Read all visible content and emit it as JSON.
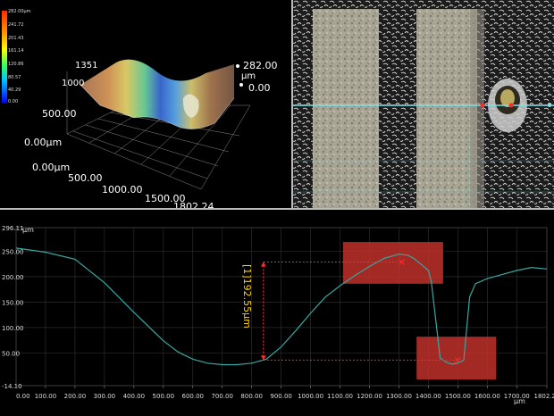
{
  "view3d": {
    "colorbar_labels": [
      "282.00µm",
      "241.72",
      "201.43",
      "161.14",
      "120.86",
      "80.57",
      "40.29",
      "0.00"
    ],
    "z_max": "282.00",
    "z_unit": "µm",
    "z_min": "0.00",
    "y_ticks": [
      "1351",
      "1000",
      "500.00",
      "0.00µm"
    ],
    "x_ticks": [
      "0.00µm",
      "500.00",
      "1000.00",
      "1500.00",
      "1802.24"
    ],
    "colors": {
      "colorbar_top": "#ff3b00",
      "colorbar_mid": "#ffff00",
      "colorbar_low": "#00c0ff",
      "colorbar_bottom": "#0000ff"
    }
  },
  "profile": {
    "y_unit": "µm",
    "y_ticks": [
      "296.11",
      "250.00",
      "200.00",
      "150.00",
      "100.00",
      "50.00",
      "-14.10"
    ],
    "x_ticks": [
      "0.00",
      "100.00",
      "200.00",
      "300.00",
      "400.00",
      "500.00",
      "600.00",
      "700.00",
      "800.00",
      "900.00",
      "1000.00",
      "1100.00",
      "1200.00",
      "1300.00",
      "1400.00",
      "1500.00",
      "1600.00",
      "1700.00",
      "1802.29"
    ],
    "x_unit": "µm",
    "measurement_label": "[1]192.55µm",
    "colors": {
      "profile_line": "#3aa6a0",
      "measure": "#ff2a2a",
      "box": "#c0302a",
      "label": "#ffd200",
      "scan_line": "#7fe0e8"
    }
  },
  "chart_data": {
    "type": "line",
    "title": "",
    "xlabel": "µm",
    "ylabel": "µm",
    "xlim": [
      0,
      1802.29
    ],
    "ylim": [
      -14.1,
      296.11
    ],
    "x": [
      0,
      100,
      200,
      300,
      400,
      500,
      550,
      600,
      650,
      700,
      750,
      800,
      850,
      900,
      950,
      1000,
      1050,
      1100,
      1150,
      1200,
      1250,
      1300,
      1330,
      1350,
      1380,
      1400,
      1410,
      1420,
      1440,
      1460,
      1480,
      1500,
      1520,
      1540,
      1560,
      1600,
      1650,
      1700,
      1750,
      1802.29
    ],
    "series": [
      {
        "values": [
          256,
          248,
          234,
          188,
          130,
          74,
          52,
          38,
          30,
          27,
          27,
          30,
          38,
          62,
          94,
          128,
          160,
          182,
          202,
          220,
          236,
          244,
          242,
          236,
          222,
          212,
          190,
          140,
          40,
          32,
          28,
          30,
          36,
          160,
          186,
          196,
          204,
          212,
          218,
          215
        ]
      }
    ],
    "annotations": [
      {
        "text": "[1]192.55µm",
        "x1": 840,
        "y1": 36,
        "x2": 1310,
        "y2": 228.55
      }
    ],
    "grid": true
  }
}
